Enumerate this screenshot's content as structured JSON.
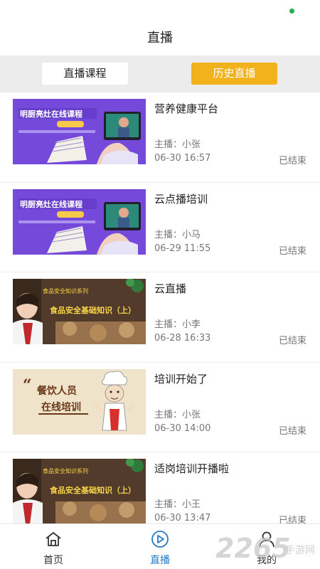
{
  "header": {
    "title": "直播"
  },
  "segment": {
    "tab_live_courses": "直播课程",
    "tab_history_live": "历史直播"
  },
  "colors": {
    "accent": "#f2b21c",
    "tab_active": "#2379c4",
    "status_dot": "#22b14c"
  },
  "thumb_texts": {
    "chef_course": "明厨亮灶在线课程",
    "food_safety": "食品安全基础知识（上）",
    "catering_line1": "餐饮人员",
    "catering_line2": "在线培训"
  },
  "items": [
    {
      "title": "营养健康平台",
      "host": "主播：小张",
      "time": "06-30 16:57",
      "status": "已结束",
      "thumb": "chef-course"
    },
    {
      "title": "云点播培训",
      "host": "主播：小马",
      "time": "06-29 11:55",
      "status": "已结束",
      "thumb": "chef-course"
    },
    {
      "title": "云直播",
      "host": "主播：小李",
      "time": "06-28 16:33",
      "status": "已结束",
      "thumb": "food-safety"
    },
    {
      "title": "培训开始了",
      "host": "主播：小张",
      "time": "06-30 14:00",
      "status": "已结束",
      "thumb": "catering-training"
    },
    {
      "title": "适岗培训开播啦",
      "host": "主播：小王",
      "time": "06-30 13:47",
      "status": "已结束",
      "thumb": "food-safety"
    }
  ],
  "tabbar": {
    "home": "首页",
    "live": "直播",
    "mine": "我的"
  },
  "watermark": {
    "text": "2265",
    "sub": "手游网"
  }
}
